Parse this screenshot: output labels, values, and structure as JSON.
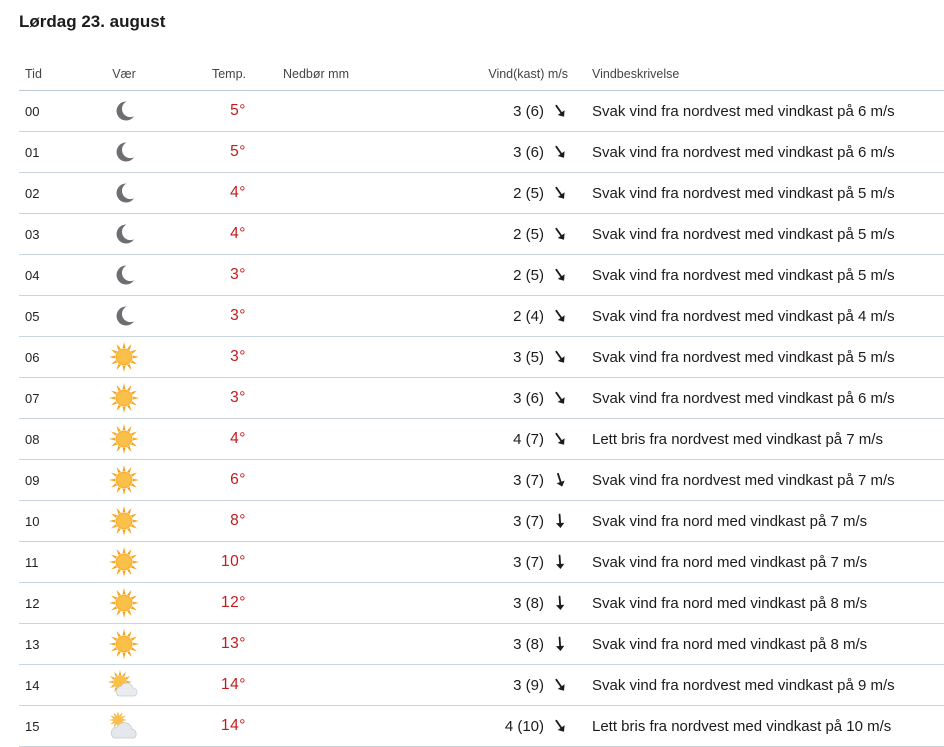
{
  "heading": "Lørdag 23. august",
  "columns": {
    "time": "Tid",
    "weather": "Vær",
    "temp": "Temp.",
    "precip": "Nedbør mm",
    "wind": "Vind(kast) m/s",
    "desc": "Vindbeskrivelse"
  },
  "colors": {
    "temp_warm": "#c21a1a",
    "moon": "#6d6e72",
    "sun": "#f7a21b",
    "divider": "#c9d6df"
  },
  "rows": [
    {
      "time": "00",
      "icon": "moon-icon",
      "temp": "5°",
      "precip": "",
      "wind": "3 (6)",
      "dir": "nw",
      "desc": "Svak vind fra nordvest med vindkast på 6 m/s"
    },
    {
      "time": "01",
      "icon": "moon-icon",
      "temp": "5°",
      "precip": "",
      "wind": "3 (6)",
      "dir": "nw",
      "desc": "Svak vind fra nordvest med vindkast på 6 m/s"
    },
    {
      "time": "02",
      "icon": "moon-icon",
      "temp": "4°",
      "precip": "",
      "wind": "2 (5)",
      "dir": "nw",
      "desc": "Svak vind fra nordvest med vindkast på 5 m/s"
    },
    {
      "time": "03",
      "icon": "moon-icon",
      "temp": "4°",
      "precip": "",
      "wind": "2 (5)",
      "dir": "nw",
      "desc": "Svak vind fra nordvest med vindkast på 5 m/s"
    },
    {
      "time": "04",
      "icon": "moon-icon",
      "temp": "3°",
      "precip": "",
      "wind": "2 (5)",
      "dir": "nw",
      "desc": "Svak vind fra nordvest med vindkast på 5 m/s"
    },
    {
      "time": "05",
      "icon": "moon-icon",
      "temp": "3°",
      "precip": "",
      "wind": "2 (4)",
      "dir": "nw",
      "desc": "Svak vind fra nordvest med vindkast på 4 m/s"
    },
    {
      "time": "06",
      "icon": "sun-icon",
      "temp": "3°",
      "precip": "",
      "wind": "3 (5)",
      "dir": "nw",
      "desc": "Svak vind fra nordvest med vindkast på 5 m/s"
    },
    {
      "time": "07",
      "icon": "sun-icon",
      "temp": "3°",
      "precip": "",
      "wind": "3 (6)",
      "dir": "nw",
      "desc": "Svak vind fra nordvest med vindkast på 6 m/s"
    },
    {
      "time": "08",
      "icon": "sun-icon",
      "temp": "4°",
      "precip": "",
      "wind": "4 (7)",
      "dir": "nw",
      "desc": "Lett bris fra nordvest med vindkast på 7 m/s"
    },
    {
      "time": "09",
      "icon": "sun-icon",
      "temp": "6°",
      "precip": "",
      "wind": "3 (7)",
      "dir": "nnw",
      "desc": "Svak vind fra nordvest med vindkast på 7 m/s"
    },
    {
      "time": "10",
      "icon": "sun-icon",
      "temp": "8°",
      "precip": "",
      "wind": "3 (7)",
      "dir": "n",
      "desc": "Svak vind fra nord med vindkast på 7 m/s"
    },
    {
      "time": "11",
      "icon": "sun-icon",
      "temp": "10°",
      "precip": "",
      "wind": "3 (7)",
      "dir": "n",
      "desc": "Svak vind fra nord med vindkast på 7 m/s"
    },
    {
      "time": "12",
      "icon": "sun-icon",
      "temp": "12°",
      "precip": "",
      "wind": "3 (8)",
      "dir": "n",
      "desc": "Svak vind fra nord med vindkast på 8 m/s"
    },
    {
      "time": "13",
      "icon": "sun-icon",
      "temp": "13°",
      "precip": "",
      "wind": "3 (8)",
      "dir": "n",
      "desc": "Svak vind fra nord med vindkast på 8 m/s"
    },
    {
      "time": "14",
      "icon": "partly-cloudy-icon",
      "temp": "14°",
      "precip": "",
      "wind": "3 (9)",
      "dir": "nw",
      "desc": "Svak vind fra nordvest med vindkast på 9 m/s"
    },
    {
      "time": "15",
      "icon": "cloud-sun-icon",
      "temp": "14°",
      "precip": "",
      "wind": "4 (10)",
      "dir": "nw",
      "desc": "Lett bris fra nordvest med vindkast på 10 m/s"
    }
  ]
}
